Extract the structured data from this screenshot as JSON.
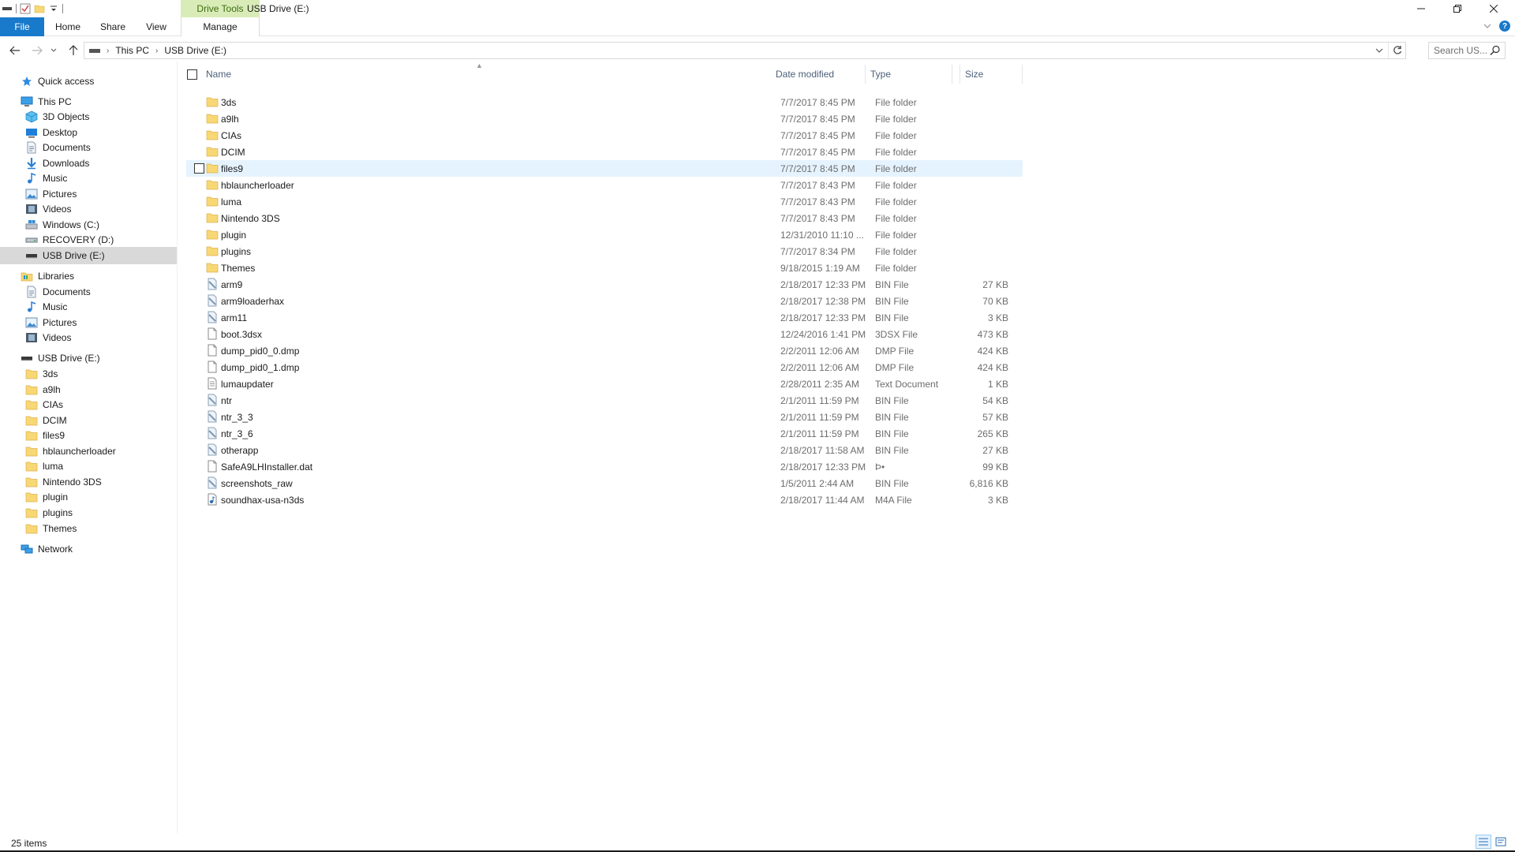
{
  "titlebar": {
    "contextual_tab": "Drive Tools",
    "window_title": "USB Drive (E:)",
    "minimize_glyph": "—",
    "restore_glyph": "❐",
    "close_glyph": "✕"
  },
  "ribbon": {
    "tabs": [
      "File",
      "Home",
      "Share",
      "View",
      "Manage"
    ]
  },
  "address": {
    "crumbs": [
      "This PC",
      "USB Drive (E:)"
    ],
    "search_placeholder": "Search US..."
  },
  "navpane": {
    "items": [
      {
        "label": "Quick access",
        "icon": "star-icon",
        "level": 0
      },
      {
        "label": "This PC",
        "icon": "computer-icon",
        "level": 0
      },
      {
        "label": "3D Objects",
        "icon": "cube-icon",
        "level": 1
      },
      {
        "label": "Desktop",
        "icon": "desktop-icon",
        "level": 1
      },
      {
        "label": "Documents",
        "icon": "document-icon",
        "level": 1
      },
      {
        "label": "Downloads",
        "icon": "download-icon",
        "level": 1
      },
      {
        "label": "Music",
        "icon": "music-icon",
        "level": 1
      },
      {
        "label": "Pictures",
        "icon": "picture-icon",
        "level": 1
      },
      {
        "label": "Videos",
        "icon": "video-icon",
        "level": 1
      },
      {
        "label": "Windows (C:)",
        "icon": "windows-drive-icon",
        "level": 1
      },
      {
        "label": "RECOVERY (D:)",
        "icon": "drive-icon",
        "level": 1
      },
      {
        "label": "USB Drive (E:)",
        "icon": "usb-drive-icon",
        "level": 1,
        "selected": true
      },
      {
        "label": "Libraries",
        "icon": "library-icon",
        "level": 0
      },
      {
        "label": "Documents",
        "icon": "document-icon",
        "level": 1
      },
      {
        "label": "Music",
        "icon": "music-icon",
        "level": 1
      },
      {
        "label": "Pictures",
        "icon": "picture-icon",
        "level": 1
      },
      {
        "label": "Videos",
        "icon": "video-icon",
        "level": 1
      },
      {
        "label": "USB Drive (E:)",
        "icon": "usb-drive-icon",
        "level": 0
      },
      {
        "label": "3ds",
        "icon": "folder-icon",
        "level": 1
      },
      {
        "label": "a9lh",
        "icon": "folder-icon",
        "level": 1
      },
      {
        "label": "CIAs",
        "icon": "folder-icon",
        "level": 1
      },
      {
        "label": "DCIM",
        "icon": "folder-icon",
        "level": 1
      },
      {
        "label": "files9",
        "icon": "folder-icon",
        "level": 1
      },
      {
        "label": "hblauncherloader",
        "icon": "folder-icon",
        "level": 1
      },
      {
        "label": "luma",
        "icon": "folder-icon",
        "level": 1
      },
      {
        "label": "Nintendo 3DS",
        "icon": "folder-icon",
        "level": 1
      },
      {
        "label": "plugin",
        "icon": "folder-icon",
        "level": 1
      },
      {
        "label": "plugins",
        "icon": "folder-icon",
        "level": 1
      },
      {
        "label": "Themes",
        "icon": "folder-icon",
        "level": 1
      },
      {
        "label": "Network",
        "icon": "network-icon",
        "level": 0
      }
    ]
  },
  "columns": {
    "name": "Name",
    "date": "Date modified",
    "type": "Type",
    "size": "Size"
  },
  "files": [
    {
      "name": "3ds",
      "date": "7/7/2017 8:45 PM",
      "type": "File folder",
      "size": "",
      "icon": "folder-icon"
    },
    {
      "name": "a9lh",
      "date": "7/7/2017 8:45 PM",
      "type": "File folder",
      "size": "",
      "icon": "folder-icon"
    },
    {
      "name": "CIAs",
      "date": "7/7/2017 8:45 PM",
      "type": "File folder",
      "size": "",
      "icon": "folder-icon"
    },
    {
      "name": "DCIM",
      "date": "7/7/2017 8:45 PM",
      "type": "File folder",
      "size": "",
      "icon": "folder-icon"
    },
    {
      "name": "files9",
      "date": "7/7/2017 8:45 PM",
      "type": "File folder",
      "size": "",
      "icon": "folder-icon",
      "hover": true
    },
    {
      "name": "hblauncherloader",
      "date": "7/7/2017 8:43 PM",
      "type": "File folder",
      "size": "",
      "icon": "folder-icon"
    },
    {
      "name": "luma",
      "date": "7/7/2017 8:43 PM",
      "type": "File folder",
      "size": "",
      "icon": "folder-icon"
    },
    {
      "name": "Nintendo 3DS",
      "date": "7/7/2017 8:43 PM",
      "type": "File folder",
      "size": "",
      "icon": "folder-icon"
    },
    {
      "name": "plugin",
      "date": "12/31/2010 11:10 ...",
      "type": "File folder",
      "size": "",
      "icon": "folder-icon"
    },
    {
      "name": "plugins",
      "date": "7/7/2017 8:34 PM",
      "type": "File folder",
      "size": "",
      "icon": "folder-icon"
    },
    {
      "name": "Themes",
      "date": "9/18/2015 1:19 AM",
      "type": "File folder",
      "size": "",
      "icon": "folder-icon"
    },
    {
      "name": "arm9",
      "date": "2/18/2017 12:33 PM",
      "type": "BIN File",
      "size": "27 KB",
      "icon": "bin-file-icon"
    },
    {
      "name": "arm9loaderhax",
      "date": "2/18/2017 12:38 PM",
      "type": "BIN File",
      "size": "70 KB",
      "icon": "bin-file-icon"
    },
    {
      "name": "arm11",
      "date": "2/18/2017 12:33 PM",
      "type": "BIN File",
      "size": "3 KB",
      "icon": "bin-file-icon"
    },
    {
      "name": "boot.3dsx",
      "date": "12/24/2016 1:41 PM",
      "type": "3DSX File",
      "size": "473 KB",
      "icon": "blank-file-icon"
    },
    {
      "name": "dump_pid0_0.dmp",
      "date": "2/2/2011 12:06 AM",
      "type": "DMP File",
      "size": "424 KB",
      "icon": "blank-file-icon"
    },
    {
      "name": "dump_pid0_1.dmp",
      "date": "2/2/2011 12:06 AM",
      "type": "DMP File",
      "size": "424 KB",
      "icon": "blank-file-icon"
    },
    {
      "name": "lumaupdater",
      "date": "2/28/2011 2:35 AM",
      "type": "Text Document",
      "size": "1 KB",
      "icon": "text-file-icon"
    },
    {
      "name": "ntr",
      "date": "2/1/2011 11:59 PM",
      "type": "BIN File",
      "size": "54 KB",
      "icon": "bin-file-icon"
    },
    {
      "name": "ntr_3_3",
      "date": "2/1/2011 11:59 PM",
      "type": "BIN File",
      "size": "57 KB",
      "icon": "bin-file-icon"
    },
    {
      "name": "ntr_3_6",
      "date": "2/1/2011 11:59 PM",
      "type": "BIN File",
      "size": "265 KB",
      "icon": "bin-file-icon"
    },
    {
      "name": "otherapp",
      "date": "2/18/2017 11:58 AM",
      "type": "BIN File",
      "size": "27 KB",
      "icon": "bin-file-icon"
    },
    {
      "name": "SafeA9LHInstaller.dat",
      "date": "2/18/2017 12:33 PM",
      "type": "Þ•",
      "size": "99 KB",
      "icon": "blank-file-icon"
    },
    {
      "name": "screenshots_raw",
      "date": "1/5/2011 2:44 AM",
      "type": "BIN File",
      "size": "6,816 KB",
      "icon": "bin-file-icon"
    },
    {
      "name": "soundhax-usa-n3ds",
      "date": "2/18/2017 11:44 AM",
      "type": "M4A File",
      "size": "3 KB",
      "icon": "audio-file-icon"
    }
  ],
  "status": {
    "item_count": "25 items"
  },
  "colors": {
    "file_tab": "#1979ca",
    "contextual_tab": "#d9ecb8",
    "folder_yellow": "#f8d775",
    "selection": "#d9d9d9",
    "hover": "#e5f3ff"
  }
}
